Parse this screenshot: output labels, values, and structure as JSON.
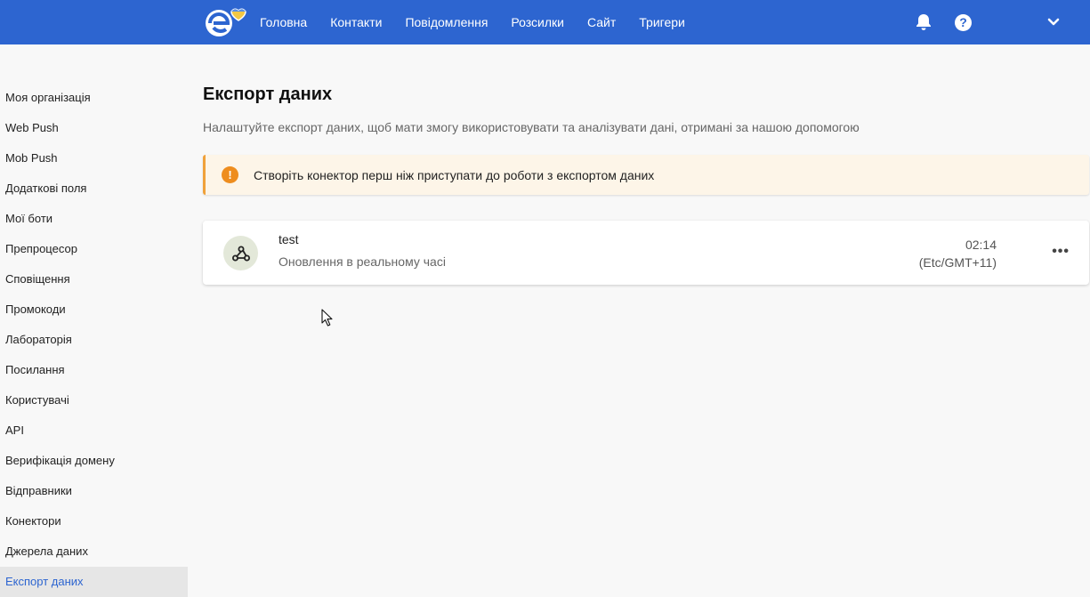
{
  "header": {
    "nav": [
      "Головна",
      "Контакти",
      "Повідомлення",
      "Розсилки",
      "Сайт",
      "Тригери"
    ],
    "icons": {
      "notifications": "bell-icon",
      "help": "question-icon",
      "account_menu": "chevron-down-icon"
    },
    "help_glyph": "?",
    "colors": {
      "bar": "#2d65d0"
    }
  },
  "sidebar": {
    "items": [
      "Моя організація",
      "Web Push",
      "Mob Push",
      "Додаткові поля",
      "Мої боти",
      "Препроцесор",
      "Сповіщення",
      "Промокоди",
      "Лабораторія",
      "Посилання",
      "Користувачі",
      "API",
      "Верифікація домену",
      "Відправники",
      "Конектори",
      "Джерела даних",
      "Експорт даних"
    ],
    "active": "Експорт даних"
  },
  "main": {
    "title": "Експорт даних",
    "subtitle": "Налаштуйте експорт даних, щоб мати змогу використовувати та аналізувати дані, отримані за нашою допомогою",
    "alert": {
      "icon": "exclamation-icon",
      "glyph": "!",
      "text": "Створіть конектор перш ніж приступати до роботи з експортом даних"
    },
    "export": {
      "name": "test",
      "mode": "Оновлення в реальному часі",
      "time": "02:14",
      "timezone": "(Etc/GMT+11)",
      "icon": "webhook-icon",
      "menu_glyph": "•••"
    }
  }
}
